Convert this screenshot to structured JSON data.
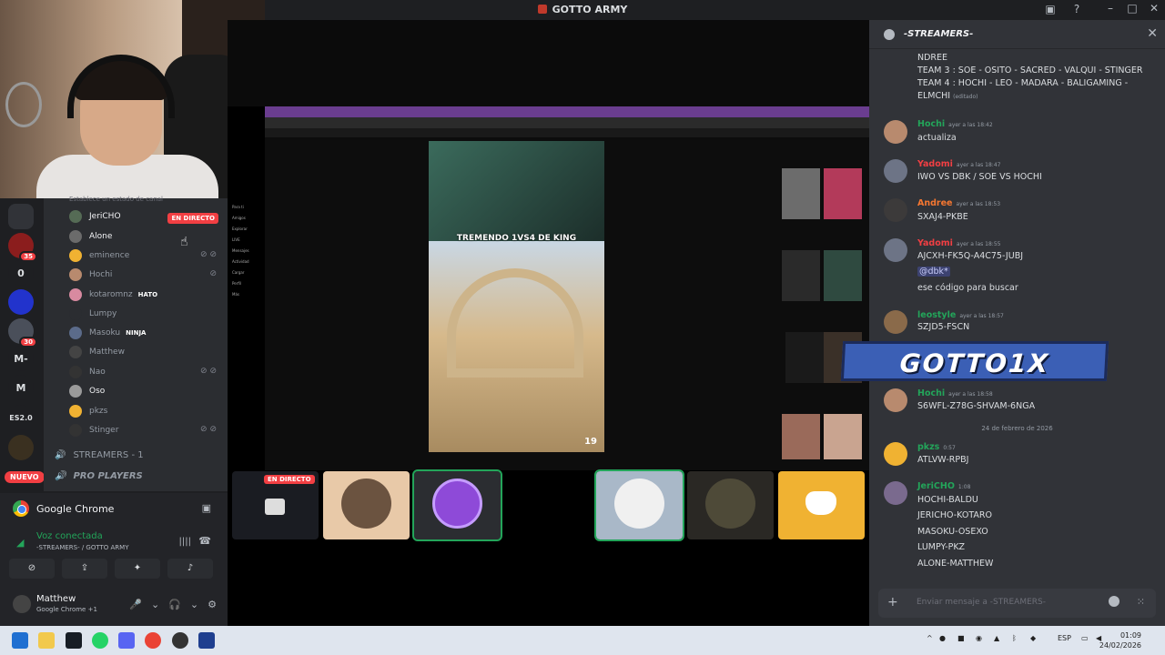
{
  "window": {
    "title": "GOTTO ARMY"
  },
  "servers": [
    {
      "label": "",
      "badge": ""
    },
    {
      "label": "",
      "badge": "35"
    },
    {
      "label": "0",
      "badge": ""
    },
    {
      "label": "",
      "badge": ""
    },
    {
      "label": "",
      "badge": "30"
    },
    {
      "label": "M-",
      "badge": ""
    },
    {
      "label": "M",
      "badge": ""
    },
    {
      "label": "ES2.0",
      "badge": ""
    },
    {
      "label": "",
      "badge": ""
    }
  ],
  "nuevo_label": "NUEVO",
  "channel_header_fragment": "Establece un estado de canal",
  "members": [
    {
      "name": "JeriCHO",
      "tag": "",
      "live": "EN DIRECTO",
      "muted": false,
      "bright": true
    },
    {
      "name": "Alone",
      "tag": "",
      "live": "",
      "muted": false,
      "bright": true
    },
    {
      "name": "eminence",
      "tag": "",
      "live": "",
      "muted": true,
      "bright": false
    },
    {
      "name": "Hochi",
      "tag": "",
      "live": "",
      "muted": true,
      "bright": false
    },
    {
      "name": "kotaromnz",
      "tag": "HATO",
      "live": "",
      "muted": false,
      "bright": false
    },
    {
      "name": "Lumpy",
      "tag": "",
      "live": "",
      "muted": false,
      "bright": false
    },
    {
      "name": "Masoku",
      "tag": "NINJA",
      "live": "",
      "muted": false,
      "bright": false
    },
    {
      "name": "Matthew",
      "tag": "",
      "live": "",
      "muted": false,
      "bright": false
    },
    {
      "name": "Nao",
      "tag": "",
      "live": "",
      "muted": true,
      "bright": false
    },
    {
      "name": "Oso",
      "tag": "",
      "live": "",
      "muted": false,
      "bright": true
    },
    {
      "name": "pkzs",
      "tag": "",
      "live": "",
      "muted": false,
      "bright": false
    },
    {
      "name": "Stinger",
      "tag": "",
      "live": "",
      "muted": true,
      "bright": false
    }
  ],
  "voice_categories": [
    {
      "label": "STREAMERS - 1"
    },
    {
      "label": "PRO PLAYERS"
    }
  ],
  "panel": {
    "app_name": "Google Chrome",
    "voice_status": "Voz conectada",
    "voice_channel": "-STREAMERS- / GOTTO ARMY",
    "user_name": "Matthew",
    "user_activity": "Google Chrome +1"
  },
  "stage": {
    "video_caption": "TREMENDO 1VS4 DE KING",
    "video_timer": "19",
    "live_label": "EN DIRECTO",
    "tiktok_sidebar": [
      "Para ti",
      "Amigos",
      "Explorar",
      "LIVE",
      "Mensajes",
      "Actividad",
      "Cargar",
      "Perfil",
      "Más"
    ]
  },
  "chat": {
    "channel_title": "-STREAMERS-",
    "continued_lines": [
      "NDREE",
      "TEAM 3 : SOE - OSITO - SACRED - VALQUI - STINGER",
      "TEAM 4 : HOCHI - LEO - MADARA - BALIGAMING -",
      "ELMCHI"
    ],
    "edited_label": "(editado)",
    "messages": [
      {
        "author": "Hochi",
        "color": "#23a55a",
        "time": "ayer a las 18:42",
        "lines": [
          "actualiza"
        ]
      },
      {
        "author": "Yadomi",
        "color": "#f23f43",
        "time": "ayer a las 18:47",
        "lines": [
          "IWO VS DBK  / SOE VS HOCHI"
        ]
      },
      {
        "author": "Andree",
        "color": "#f57731",
        "time": "ayer a las 18:53",
        "lines": [
          "SXAJ4-PKBE"
        ]
      },
      {
        "author": "Yadomi",
        "color": "#f23f43",
        "time": "ayer a las 18:55",
        "lines": [
          "AJCXH-FK5Q-A4C75-JUBJ",
          "@dbk*",
          "ese código para buscar"
        ]
      },
      {
        "author": "leostyle",
        "color": "#23a55a",
        "time": "ayer a las 18:57",
        "lines": [
          "SZJD5-FSCN"
        ]
      },
      {
        "author": "Hochi",
        "color": "#23a55a",
        "time": "ayer a las 18:58",
        "lines": [
          "S6WFL-Z78G-SHVAM-6NGA"
        ]
      },
      {
        "author": "pkzs",
        "color": "#23a55a",
        "time": "0:57",
        "lines": [
          "ATLVW-RPBJ"
        ]
      },
      {
        "author": "JeriCHO",
        "color": "#23a55a",
        "time": "1:08",
        "lines": [
          "HOCHI-BALDU",
          "JERICHO-KOTARO",
          "MASOKU-OSEXO",
          "LUMPY-PKZ",
          "ALONE-MATTHEW"
        ]
      }
    ],
    "date_divider": "24 de febrero de 2026",
    "composer_placeholder": "Enviar mensaje a -STREAMERS-"
  },
  "overlay_banner": "GOTTO1X",
  "taskbar": {
    "language": "ESP",
    "time": "01:09",
    "date": "24/02/2026"
  }
}
